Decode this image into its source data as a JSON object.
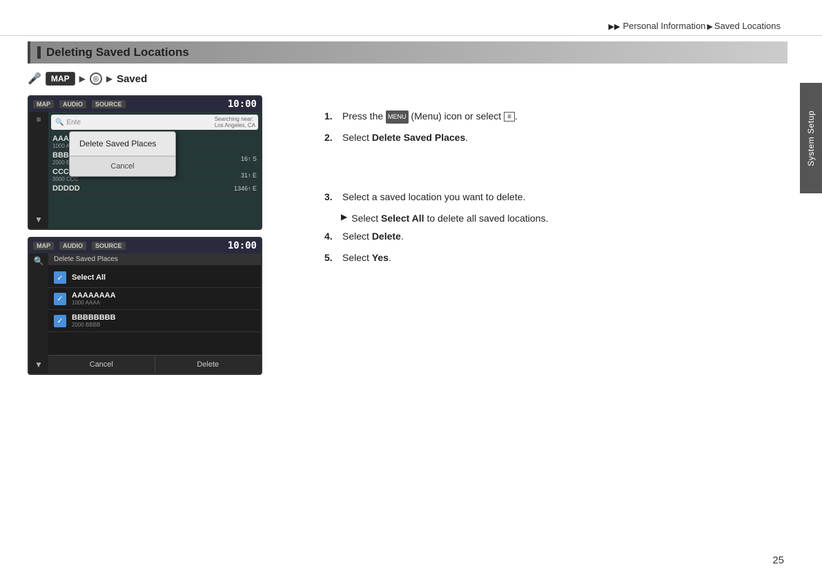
{
  "breadcrumb": {
    "part1": "Personal Information",
    "part2": "Saved Locations",
    "arrow": "▶▶"
  },
  "side_tab": {
    "label": "System Setup"
  },
  "page_number": "25",
  "section": {
    "title": "Deleting Saved Locations"
  },
  "nav_path": {
    "icon": "🎤",
    "map_btn": "MAP",
    "arrow1": "▶",
    "circle": "◎",
    "arrow2": "▶",
    "saved": "Saved"
  },
  "screen1": {
    "topbar_btns": [
      "MAP",
      "AUDIO",
      "SOURCE"
    ],
    "time": "10:00",
    "search_placeholder": "Ente",
    "search_hint": "Searching near:\nLos Angeles, CA",
    "list_items": [
      {
        "name": "AAAAAA",
        "sub": "1000 AAAA",
        "dist": ""
      },
      {
        "name": "BBBBBB",
        "sub": "2000 BBB",
        "dist": "16↑ S"
      },
      {
        "name": "CCCCC",
        "sub": "3000 CCC",
        "dist": "31↑ E"
      },
      {
        "name": "DDDDD",
        "sub": "",
        "dist": "1346↑ E"
      }
    ],
    "dialog": {
      "items": [
        "Delete Saved Places"
      ],
      "cancel": "Cancel"
    }
  },
  "screen2": {
    "topbar_btns": [
      "MAP",
      "AUDIO",
      "SOURCE"
    ],
    "time": "10:00",
    "header": "Delete Saved Places",
    "list_items": [
      {
        "name": "Select All",
        "sub": "",
        "checked": true
      },
      {
        "name": "AAAAAAAA",
        "sub": "1000 AAAA",
        "checked": true
      },
      {
        "name": "BBBBBBBB",
        "sub": "2000 BBBB",
        "checked": true
      }
    ],
    "footer_btns": [
      "Cancel",
      "Delete"
    ]
  },
  "instructions": {
    "step1_prefix": "Press the",
    "step1_menu": "MENU",
    "step1_suffix": "(Menu) icon or select",
    "step2_prefix": "Select",
    "step2_bold": "Delete Saved Places",
    "step2_suffix": ".",
    "step3_prefix": "Select a saved location you want to delete.",
    "step3a_prefix": "Select",
    "step3a_bold": "Select All",
    "step3a_suffix": "to delete all saved locations.",
    "step4_prefix": "Select",
    "step4_bold": "Delete",
    "step4_suffix": ".",
    "step5_prefix": "Select",
    "step5_bold": "Yes",
    "step5_suffix": "."
  }
}
